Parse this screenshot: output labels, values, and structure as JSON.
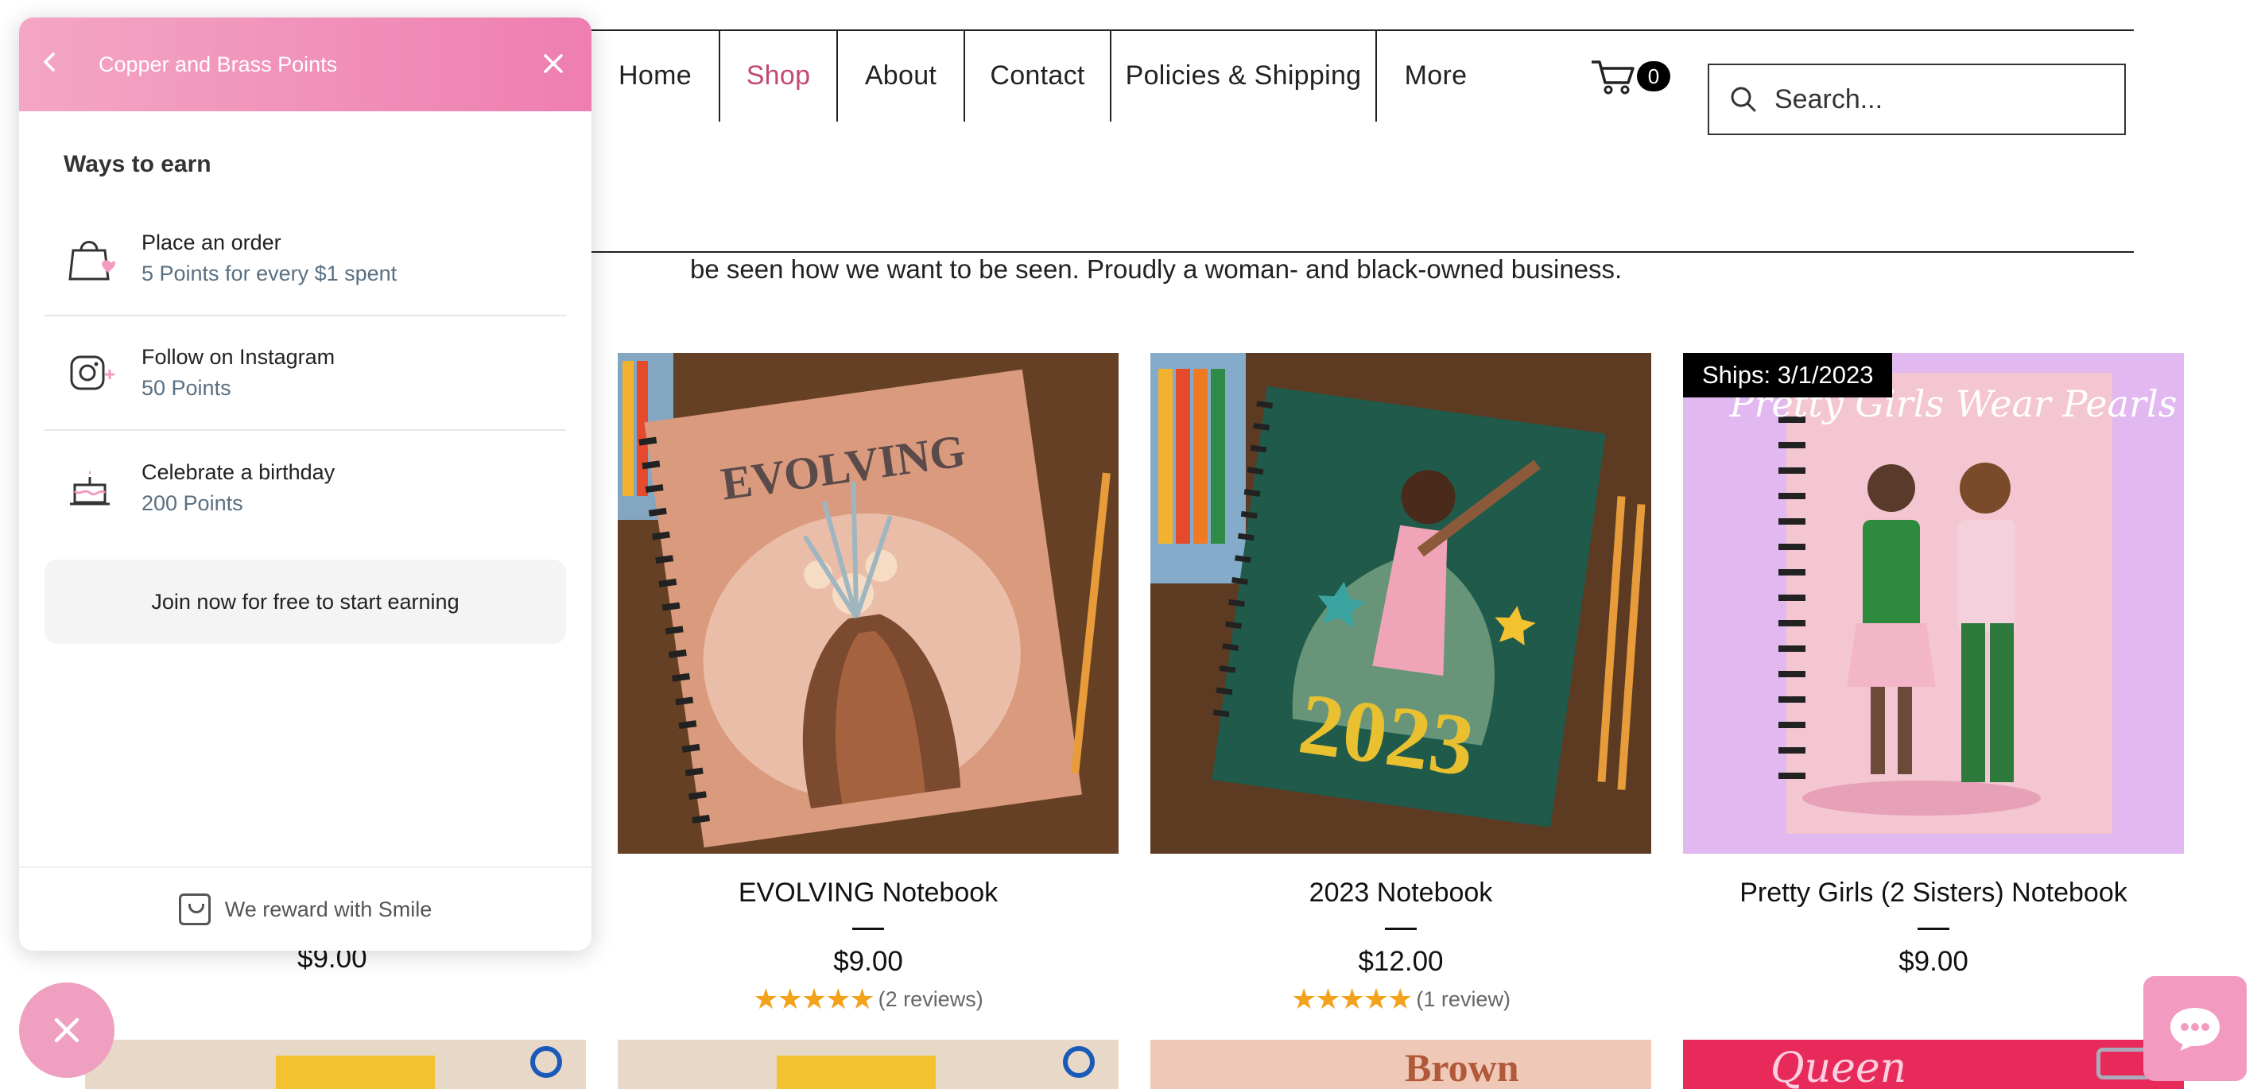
{
  "nav": {
    "items": [
      "Home",
      "Shop",
      "About",
      "Contact",
      "Policies & Shipping",
      "More"
    ],
    "active": "Shop",
    "cart_count": "0",
    "search_placeholder": "Search..."
  },
  "intro_text": "be seen how we want to be seen. Proudly a woman- and black-owned business.",
  "left_partial_price": "$9.00",
  "products": [
    {
      "name": "EVOLVING Notebook",
      "price": "$9.00",
      "rating": 5,
      "reviews": "(2 reviews)",
      "cover_title": "EVOLVING"
    },
    {
      "name": "2023 Notebook",
      "price": "$12.00",
      "rating": 5,
      "reviews": "(1 review)",
      "cover_title": "2023"
    },
    {
      "name": "Pretty Girls (2 Sisters) Notebook",
      "price": "$9.00",
      "badge": "Ships: 3/1/2023",
      "cover_title": "Pretty Girls Wear Pearls"
    }
  ],
  "bottom_row": {
    "brown_label": "Brown",
    "queen_label": "Queen"
  },
  "panel": {
    "title": "Copper and Brass Points",
    "subtitle": "Ways to earn",
    "ways": [
      {
        "title": "Place an order",
        "points": "5 Points for every $1 spent",
        "icon": "shopping-bag-icon"
      },
      {
        "title": "Follow on Instagram",
        "points": "50 Points",
        "icon": "instagram-icon"
      },
      {
        "title": "Celebrate a birthday",
        "points": "200 Points",
        "icon": "birthday-cake-icon"
      }
    ],
    "join_label": "Join now for free to start earning",
    "footer": "We reward with Smile"
  },
  "colors": {
    "accent_pink": "#ee7eb0",
    "nav_active": "#c24a6e",
    "stars": "#f3a21b"
  }
}
